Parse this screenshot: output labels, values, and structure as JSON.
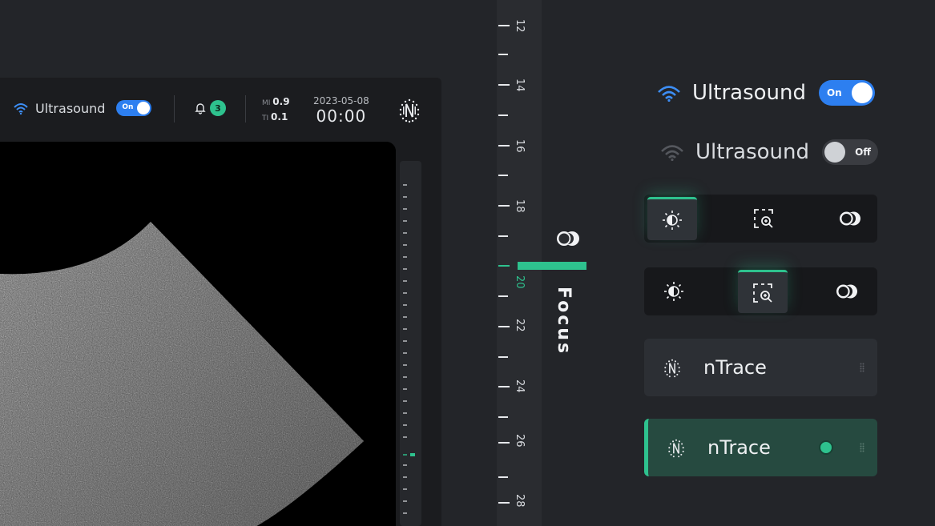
{
  "device": {
    "ultrasound_label": "Ultrasound",
    "toggle_text": "On",
    "notifications": "3",
    "mi_label": "MI",
    "mi_value": "0.9",
    "ti_label": "TI",
    "ti_value": "0.1",
    "date": "2023-05-08",
    "time": "00:00"
  },
  "ruler": {
    "labels": [
      "12",
      "14",
      "16",
      "18",
      "20",
      "22",
      "24",
      "26",
      "28"
    ],
    "active": "20",
    "focus_label": "Focus"
  },
  "showcase": {
    "us_on_label": "Ultrasound",
    "us_on_toggle": "On",
    "us_off_label": "Ultrasound",
    "us_off_toggle": "Off",
    "card1_name": "nTrace",
    "card2_name": "nTrace"
  },
  "colors": {
    "accent": "#2ec28e",
    "toggle_on": "#2d7ff0",
    "background": "#232529"
  }
}
